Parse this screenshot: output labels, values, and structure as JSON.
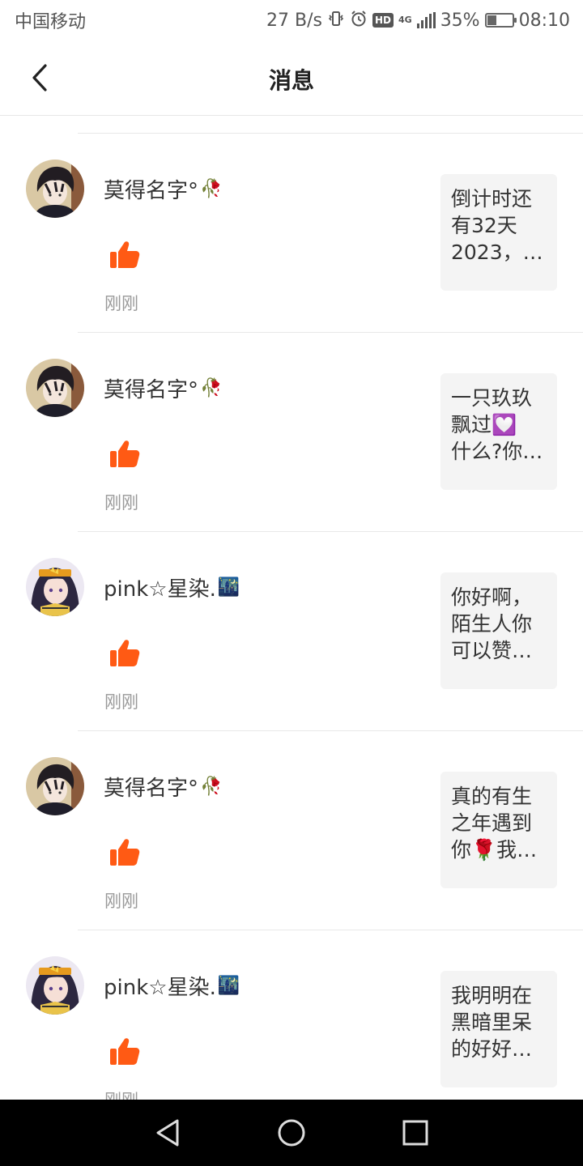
{
  "status_bar": {
    "carrier": "中国移动",
    "net_speed": "27 B/s",
    "hd_label": "HD",
    "network_type": "4G",
    "battery_percent": "35%",
    "time": "08:10",
    "icons": [
      "vibrate-icon",
      "alarm-icon",
      "hd-icon",
      "signal-icon",
      "battery-icon"
    ]
  },
  "header": {
    "title": "消息",
    "back_icon": "chevron-left-icon"
  },
  "notifications": [
    {
      "avatar": "boy-avatar",
      "username": "莫得名字°",
      "name_emoji": "🥀",
      "action_icon": "thumbs-up-icon",
      "time": "刚刚",
      "quote_lines": [
        "倒计时还",
        "有32天",
        "2023，…"
      ]
    },
    {
      "avatar": "boy-avatar",
      "username": "莫得名字°",
      "name_emoji": "🥀",
      "action_icon": "thumbs-up-icon",
      "time": "刚刚",
      "quote_lines": [
        "一只玖玖",
        "飘过💟",
        "什么?你…"
      ]
    },
    {
      "avatar": "girl-avatar",
      "username": "pink☆星染.",
      "name_emoji": "🌃",
      "action_icon": "thumbs-up-icon",
      "time": "刚刚",
      "quote_lines": [
        "你好啊，",
        "陌生人你",
        "可以赞…"
      ]
    },
    {
      "avatar": "boy-avatar",
      "username": "莫得名字°",
      "name_emoji": "🥀",
      "action_icon": "thumbs-up-icon",
      "time": "刚刚",
      "quote_lines": [
        "真的有生",
        "之年遇到",
        "你🌹我…"
      ]
    },
    {
      "avatar": "girl-avatar",
      "username": "pink☆星染.",
      "name_emoji": "🌃",
      "action_icon": "thumbs-up-icon",
      "time": "刚刚",
      "quote_lines": [
        "我明明在",
        "黑暗里呆",
        "的好好…"
      ]
    }
  ],
  "colors": {
    "like_orange": "#ff5a14",
    "time_gray": "#999999",
    "card_bg": "#f4f4f4"
  },
  "system_nav": {
    "icons": [
      "back-triangle-icon",
      "home-circle-icon",
      "recents-square-icon"
    ]
  }
}
